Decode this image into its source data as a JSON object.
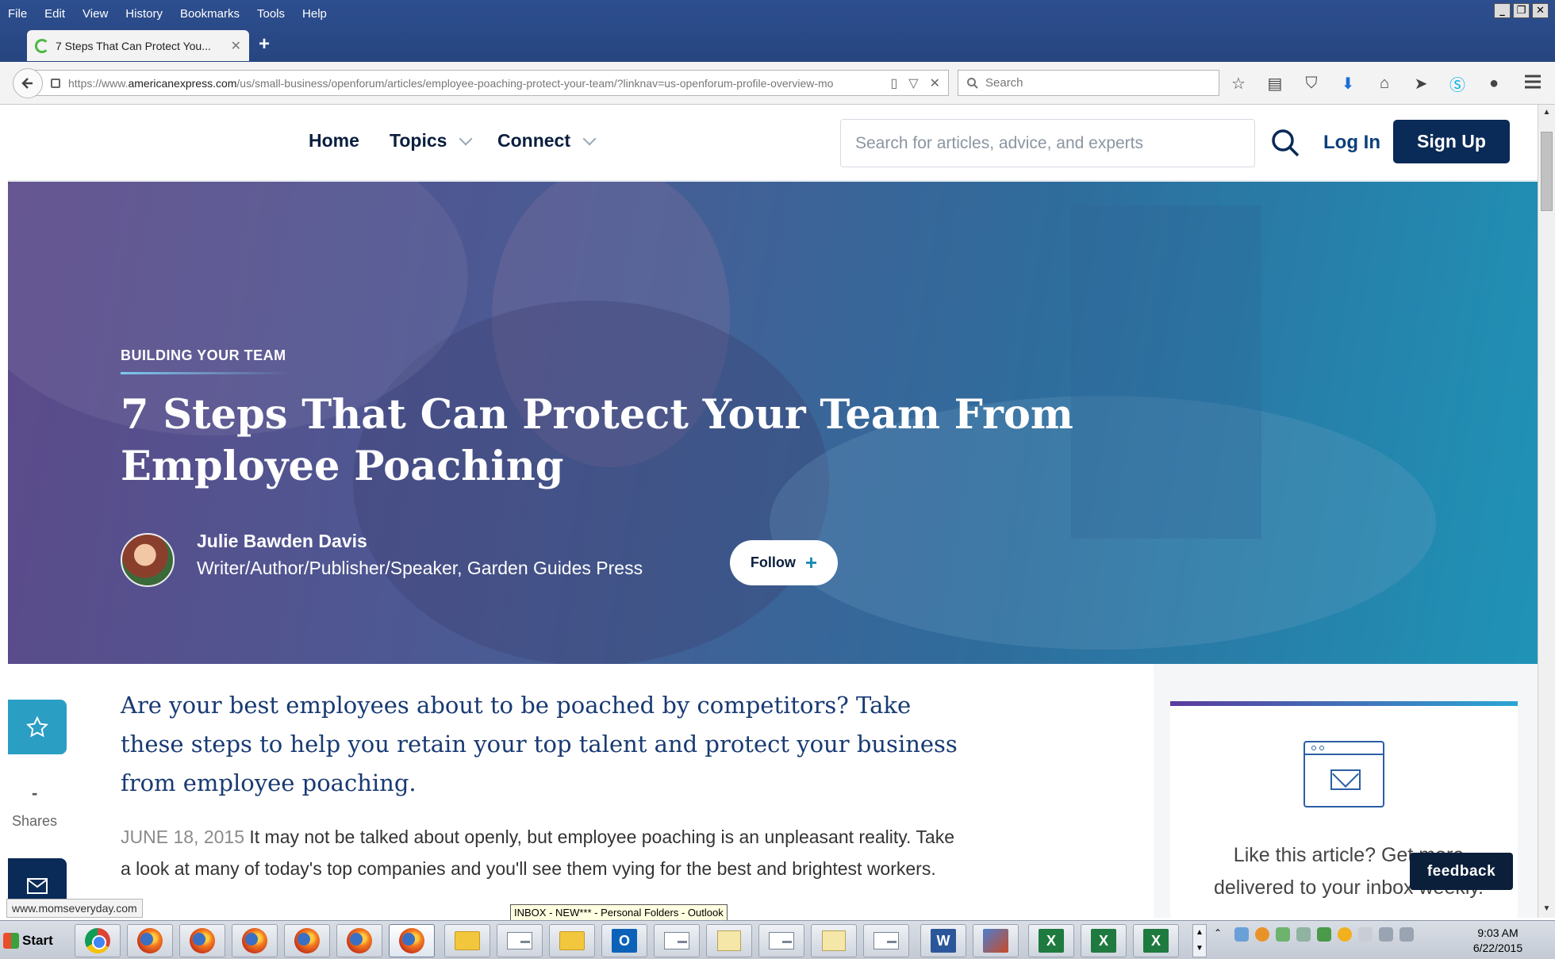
{
  "browser": {
    "menu": [
      "File",
      "Edit",
      "View",
      "History",
      "Bookmarks",
      "Tools",
      "Help"
    ],
    "tab_title": "7 Steps That Can Protect You...",
    "url_prefix": "https://www.",
    "url_host": "americanexpress.com",
    "url_path": "/us/small-business/openforum/articles/employee-poaching-protect-your-team/?linknav=us-openforum-profile-overview-mo",
    "search_placeholder": "Search",
    "status_url": "www.momseveryday.com"
  },
  "site": {
    "nav": {
      "home": "Home",
      "topics": "Topics",
      "connect": "Connect"
    },
    "search_placeholder": "Search for articles, advice, and experts",
    "login": "Log In",
    "signup": "Sign Up"
  },
  "hero": {
    "category": "BUILDING YOUR TEAM",
    "title": "7 Steps That Can Protect Your Team From Employee Poaching",
    "author_name": "Julie Bawden Davis",
    "author_title": "Writer/Author/Publisher/Speaker, Garden Guides Press",
    "follow_label": "Follow"
  },
  "share": {
    "count": "-",
    "label": "Shares"
  },
  "article": {
    "lede": "Are your best employees about to be poached by competitors? Take these steps to help you retain your top talent and protect your business from employee poaching.",
    "date": "JUNE 18, 2015",
    "body": "It may not be talked about openly, but employee poaching is an unpleasant reality. Take a look at many of today's top companies and you'll see them vying for the best and brightest workers."
  },
  "sidebar": {
    "newsletter_text": "Like this article? Get more delivered to your inbox weekly."
  },
  "feedback_label": "feedback",
  "tooltip": "INBOX - NEW*** - Personal Folders - Outlook",
  "taskbar": {
    "start": "Start",
    "time": "9:03 AM",
    "date": "6/22/2015"
  },
  "colors": {
    "navy": "#0a2a57",
    "accent_blue": "#2a9ec3",
    "lede_blue": "#183a73"
  }
}
